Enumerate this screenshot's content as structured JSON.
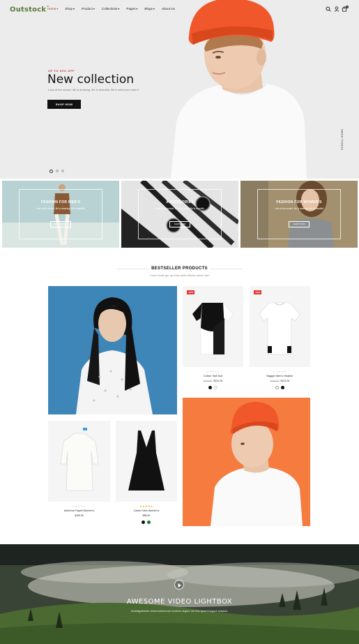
{
  "header": {
    "logo": "Outstock",
    "logo_mark": "™",
    "nav": [
      {
        "label": "Home",
        "active": true,
        "caret": true
      },
      {
        "label": "Shop",
        "active": false,
        "caret": true
      },
      {
        "label": "Product",
        "active": false,
        "caret": true
      },
      {
        "label": "Collections",
        "active": false,
        "caret": true
      },
      {
        "label": "Pages",
        "active": false,
        "caret": true
      },
      {
        "label": "Blogs",
        "active": false,
        "caret": true
      },
      {
        "label": "About Us",
        "active": false,
        "caret": false
      }
    ],
    "icons": [
      "search-icon",
      "user-icon",
      "cart-icon"
    ],
    "cart_count": "0"
  },
  "hero": {
    "subtitle": "UP TO 50% OFF",
    "title": "New collection",
    "description": "Look at the sunset, life is amazing, life is beautiful, life is what you make it",
    "button": "SHOP NOW",
    "scroll_label": "SCROLL DOWN"
  },
  "banners": [
    {
      "title": "FASHION FOR MEN'S",
      "desc": "Look at the sunset, life is amazing, life is beautiful",
      "button": "SHOP NOW"
    },
    {
      "title": "ACCESSORIES",
      "desc": "Look at the sunset, life is amazing, life is beautiful",
      "button": "SHOP NOW"
    },
    {
      "title": "FASHION FOR WOMEN'S",
      "desc": "Look at the sunset, life is amazing, life is beautiful",
      "button": "SHOP NOW"
    }
  ],
  "bestseller": {
    "title": "BESTSELLER PRODUCTS",
    "subtitle": "Lorem mods typi, qui nunc nobis videntur parum clari"
  },
  "products": [
    {
      "name": "Cotton Twill Suit",
      "old_price": "$179.00",
      "price": "$131.26",
      "badge": "-28%",
      "stars": "★★★★★",
      "rated": false
    },
    {
      "name": "Nagger Men's Heather",
      "old_price": "$179.00",
      "price": "$131.26",
      "badge": "-28%",
      "stars": "★★★★★",
      "rated": false
    },
    {
      "name": "Adrienne Fayett Women's",
      "old_price": "",
      "price": "$160.00",
      "badge": "",
      "stars": "★★★★★",
      "rated": false
    },
    {
      "name": "Calvin Klein Women's",
      "old_price": "",
      "price": "$85.00",
      "badge": "",
      "stars": "★★★★★",
      "rated": true
    }
  ],
  "video": {
    "title": "AWESOME VIDEO LIGHTBOX",
    "desc": "Investigationes demonstraverunt lectores legere me lius quod ii legunt saepius."
  },
  "colors": {
    "accent_red": "#c0392b",
    "sale_red": "#e53935",
    "logo_green": "#5a7a3a",
    "orange_bg": "#f57b3f",
    "blue_bg": "#3f86b8",
    "star_gold": "#f5a623"
  }
}
